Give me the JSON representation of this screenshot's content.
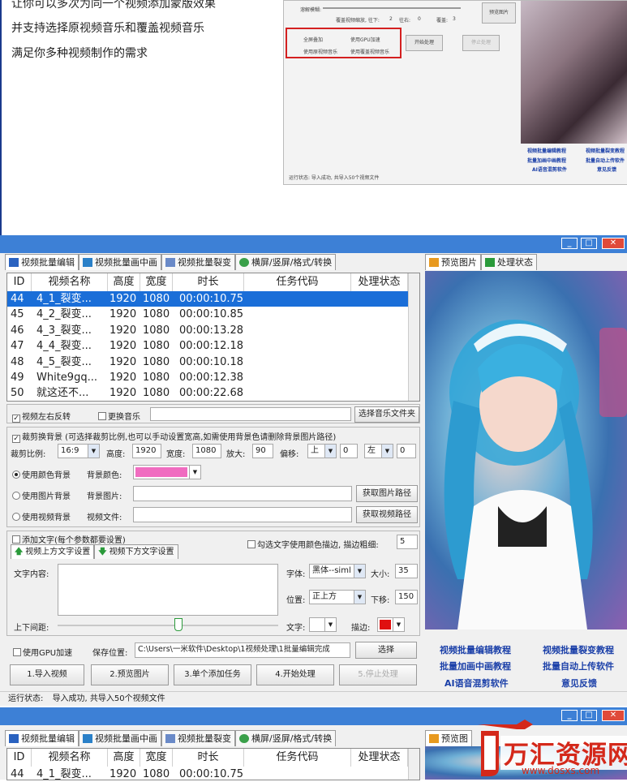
{
  "intro_lines": [
    "让你可以多次为同一个视频添加蒙版效果",
    "并支持选择原视频音乐和覆盖视频音乐",
    "满足你多种视频制作的需求"
  ],
  "mini": {
    "row1": "溶解模糊:",
    "row2_label": "覆盖视频缩放, 往下:",
    "row2_v1": "2",
    "row2_v2": "往右:",
    "row2_v3": "0",
    "row2_v4": "覆盖:",
    "row2_v5": "3",
    "preview_btn": "预览图片",
    "opt1": "全屏叠加",
    "opt2": "使用GPU加速",
    "opt3": "使用原视频音乐",
    "opt4": "使用覆盖视频音乐",
    "start_btn": "开始处理",
    "stop_btn": "停止处理",
    "status": "运行状态:   导入成功, 共导入50个视频文件",
    "links": [
      "视频批量编辑教程",
      "视频批量裂变教程",
      "批量加画中画教程",
      "批量自动上传软件",
      "AI语音混剪软件",
      "意见反馈"
    ]
  },
  "window": {
    "min_btn": "_",
    "max_btn": "□",
    "close_btn": "✕",
    "tabs": [
      "视频批量编辑",
      "视频批量画中画",
      "视频批量裂变",
      "横屏/竖屏/格式/转换"
    ],
    "right_tabs": [
      "预览图片",
      "处理状态"
    ],
    "columns": [
      "ID",
      "视频名称",
      "高度",
      "宽度",
      "时长",
      "任务代码",
      "处理状态"
    ],
    "rows": [
      [
        "44",
        "4_1_裂变...",
        "1920",
        "1080",
        "00:00:10.75"
      ],
      [
        "45",
        "4_2_裂变...",
        "1920",
        "1080",
        "00:00:10.85"
      ],
      [
        "46",
        "4_3_裂变...",
        "1920",
        "1080",
        "00:00:13.28"
      ],
      [
        "47",
        "4_4_裂变...",
        "1920",
        "1080",
        "00:00:12.18"
      ],
      [
        "48",
        "4_5_裂变...",
        "1920",
        "1080",
        "00:00:10.18"
      ],
      [
        "49",
        "White9gq...",
        "1920",
        "1080",
        "00:00:12.38"
      ],
      [
        "50",
        "就这还不...",
        "1920",
        "1080",
        "00:00:22.68"
      ]
    ],
    "flip_label": "视频左右反转",
    "music_label": "更换音乐",
    "music_btn": "选择音乐文件夹",
    "crop_label": "裁剪换背景 (可选择裁剪比例,也可以手动设置宽高,如需使用背景色请删除背景图片路径)",
    "ratio_label": "裁剪比例:",
    "ratio_value": "16:9",
    "height_label": "高度:",
    "height_value": "1920",
    "width_label": "宽度:",
    "width_value": "1080",
    "zoom_label": "放大:",
    "zoom_value": "90",
    "offset_label": "偏移:",
    "offset_dir1": "上",
    "offset_v1": "0",
    "offset_dir2": "左",
    "offset_v2": "0",
    "bg_color_radio": "使用颜色背景",
    "bg_color_label": "背景颜色:",
    "bg_color": "#f06cc0",
    "bg_img_radio": "使用图片背景",
    "bg_img_label": "背景图片:",
    "bg_img_btn": "获取图片路径",
    "bg_video_radio": "使用视频背景",
    "bg_video_label": "视频文件:",
    "bg_video_btn": "获取视频路径",
    "text_label": "添加文字(每个参数都要设置)",
    "text_tab1": "视频上方文字设置",
    "text_tab2": "视频下方文字设置",
    "stroke_label": "勾选文字使用颜色描边, 描边粗细:",
    "stroke_value": "5",
    "content_label": "文字内容:",
    "font_label": "字体:",
    "font_value": "黑体--siml",
    "size_label": "大小:",
    "size_value": "35",
    "pos_label": "位置:",
    "pos_value": "正上方",
    "down_label": "下移:",
    "down_value": "150",
    "spacing_label": "上下间距:",
    "textcolor_label": "文字:",
    "textcolor": "#ffffff",
    "strokecolor_label": "描边:",
    "strokecolor": "#e01010",
    "gpu_label": "使用GPU加速",
    "save_label": "保存位置:",
    "save_path": "C:\\Users\\一米软件\\Desktop\\1视频处理\\1批量编辑完成",
    "choose_btn": "选择",
    "step1": "1.导入视频",
    "step2": "2.预览图片",
    "step3": "3.单个添加任务",
    "step4": "4.开始处理",
    "step5": "5.停止处理",
    "status_label": "运行状态:",
    "status_text": "导入成功, 共导入50个视频文件",
    "links": [
      "视频批量编辑教程",
      "视频批量裂变教程",
      "批量加画中画教程",
      "批量自动上传软件",
      "AI语音混剪软件",
      "意见反馈"
    ]
  },
  "window2": {
    "tabs": [
      "视频批量编辑",
      "视频批量画中画",
      "视频批量裂变",
      "横屏/竖屏/格式/转换"
    ],
    "right_tab": "预览图",
    "columns": [
      "ID",
      "视频名称",
      "高度",
      "宽度",
      "时长",
      "任务代码",
      "处理状态"
    ],
    "row": [
      "44",
      "4_1_裂变...",
      "1920",
      "1080",
      "00:00:10.75"
    ]
  },
  "watermark": {
    "name": "万汇资源网",
    "url": "www.dosxs.com"
  },
  "colors": {
    "titlebar": "#3d80d6",
    "selection": "#1a6ed8",
    "link": "#1a3fa8",
    "accent_red": "#d42020"
  }
}
